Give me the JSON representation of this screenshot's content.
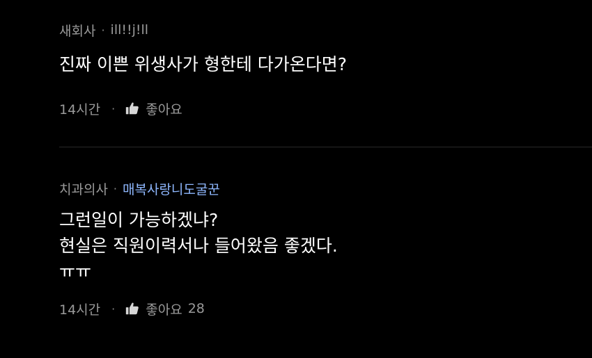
{
  "comments": [
    {
      "role": "새회사",
      "separator": "·",
      "nickname": "ill!!j!ll",
      "lines": [
        "진짜 이쁜 위생사가 형한테 다가온다면?"
      ],
      "time": "14시간",
      "time_separator": "·",
      "like_label": "좋아요",
      "like_count": ""
    },
    {
      "role": "치과의사",
      "separator": "·",
      "nickname": "매복사랑니도굴꾼",
      "lines": [
        "그런일이 가능하겠냐?",
        "현실은 직원이력서나 들어왔음 좋겠다.",
        "ㅠㅠ"
      ],
      "time": "14시간",
      "time_separator": "·",
      "like_label": "좋아요",
      "like_count": "28"
    }
  ],
  "colors": {
    "background": "#000000",
    "text": "#ffffff",
    "meta": "#9a9a9a",
    "nickname_highlight": "#8fb8ff",
    "divider": "#2a2a2a"
  },
  "icons": {
    "like": "thumbs-up-icon"
  }
}
